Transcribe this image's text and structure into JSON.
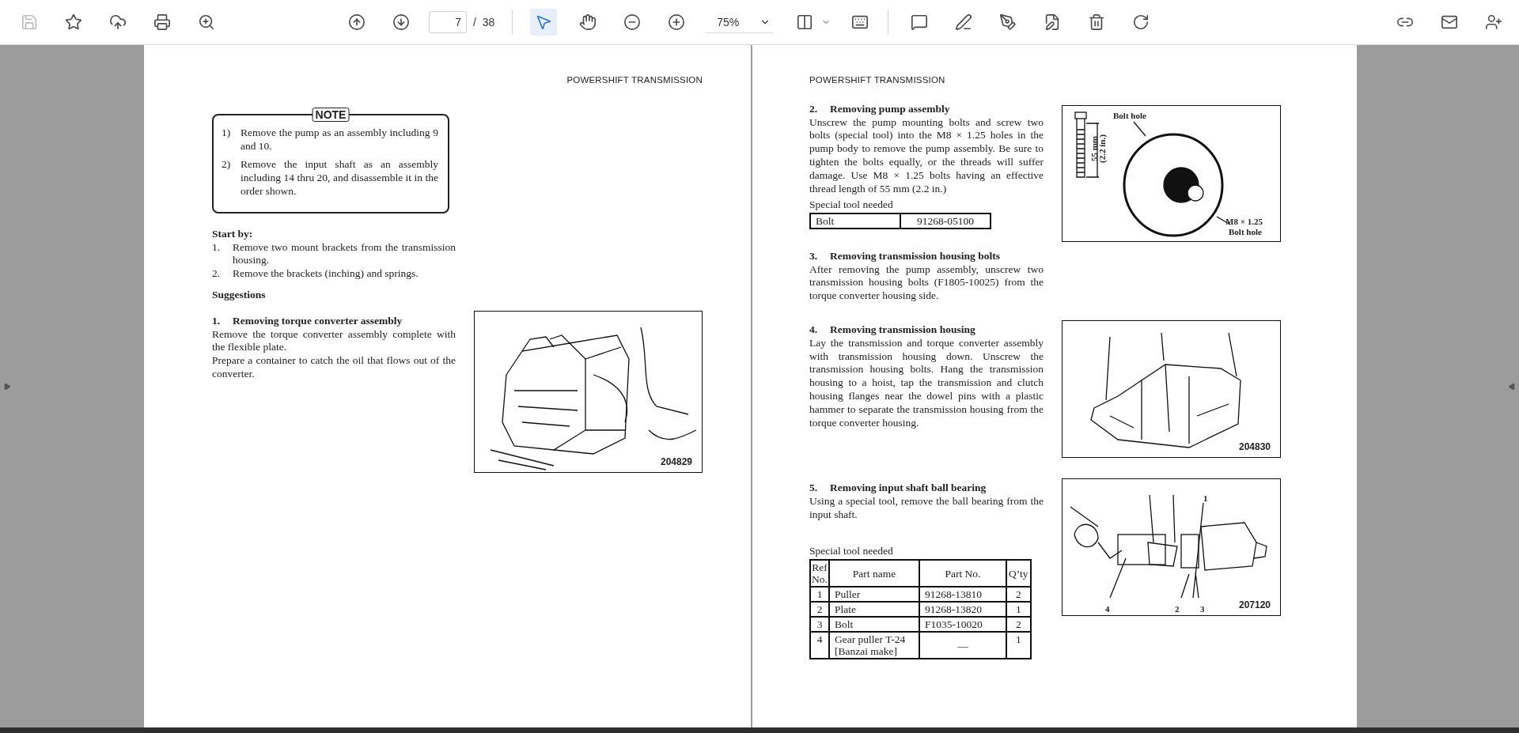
{
  "toolbar": {
    "save": {
      "disabled": true
    },
    "page": {
      "current": "7",
      "separator": "/",
      "total": "38"
    },
    "tools": [
      {
        "kind": "pointer",
        "selected": true
      },
      {
        "kind": "hand",
        "selected": false
      }
    ],
    "zoom": "75%"
  },
  "left_page": {
    "header": "POWERSHIFT TRANSMISSION",
    "note": {
      "label": "NOTE",
      "items": [
        {
          "number": "1)",
          "text": "Remove the pump as an assembly including 9 and 10."
        },
        {
          "number": "2)",
          "text": "Remove the input shaft as an assembly including 14 thru 20, and disassemble it in the order shown."
        }
      ]
    },
    "start_by": {
      "title": "Start by:",
      "items": [
        {
          "number": "1.",
          "text": "Remove two mount brackets from the transmission housing."
        },
        {
          "number": "2.",
          "text": "Remove the brackets (inching) and springs."
        }
      ]
    },
    "suggestions_title": "Suggestions",
    "section": {
      "number": "1.",
      "title": "Removing torque converter assembly",
      "paragraphs": [
        "Remove the torque converter assembly complete with the flexible plate.",
        "Prepare a container to catch the oil that flows out of the converter."
      ]
    },
    "figure": {
      "kind": "converter",
      "code": "204829"
    }
  },
  "right_page": {
    "header": "POWERSHIFT TRANSMISSION",
    "sections": [
      {
        "number": "2.",
        "title": "Removing pump assembly",
        "paragraphs": [
          "Unscrew the pump mounting bolts and screw two bolts (special tool) into the M8 × 1.25 holes in the pump body to remove the pump assembly.  Be sure to tighten the bolts equally, or the threads will suffer damage.  Use M8 × 1.25 bolts having an effective thread length of 55 mm (2.2 in.)"
        ],
        "table": {
          "kind": "simple",
          "caption": "Special tool needed",
          "rows": [
            [
              "Bolt",
              "91268-05100"
            ]
          ]
        },
        "figure": {
          "kind": "pump",
          "labels": [
            "Bolt hole",
            "55 mm",
            "(2.2 in.)",
            "M8 × 1.25",
            "Bolt hole"
          ]
        }
      },
      {
        "number": "3.",
        "title": "Removing transmission housing bolts",
        "paragraphs": [
          "After removing the pump assembly, unscrew two transmission housing bolts (F1805-10025) from the torque converter housing side."
        ]
      },
      {
        "number": "4.",
        "title": "Removing transmission housing",
        "paragraphs": [
          "Lay the transmission and torque converter assembly with transmission housing down. Unscrew the transmission housing bolts. Hang the transmission housing to a hoist, tap the transmission and clutch housing flanges near the dowel pins with a plastic hammer to separate the transmission housing from the torque converter housing."
        ],
        "figure": {
          "kind": "housing",
          "code": "204830"
        }
      },
      {
        "number": "5.",
        "title": "Removing input shaft ball bearing",
        "paragraphs": [
          "Using a special tool, remove the ball bearing from the input shaft."
        ],
        "table": {
          "kind": "parts",
          "caption": "Special tool needed",
          "columns": [
            "Ref No.",
            "Part name",
            "Part No.",
            "Q’ty"
          ],
          "rows": [
            [
              "1",
              "Puller",
              "91268-13810",
              "2"
            ],
            [
              "2",
              "Plate",
              "91268-13820",
              "1"
            ],
            [
              "3",
              "Bolt",
              "F1035-10020",
              "2"
            ],
            [
              "4",
              "Gear puller T-24 [Banzai make]",
              "—",
              "1"
            ]
          ]
        },
        "figure": {
          "kind": "shaft",
          "code": "207120",
          "labels": [
            "1",
            "4",
            "2",
            "3"
          ]
        }
      }
    ]
  }
}
